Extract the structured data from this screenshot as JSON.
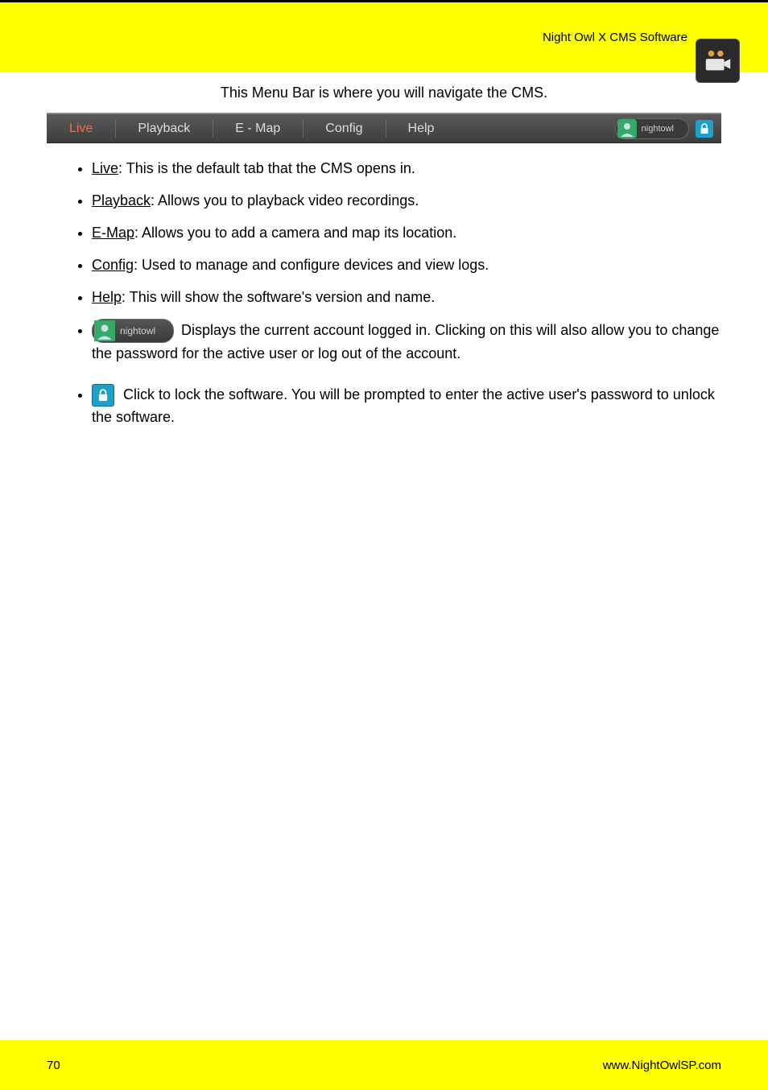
{
  "header": {
    "right_text": "Night Owl X CMS Software"
  },
  "content": {
    "intro": "This Menu Bar is where you will navigate the CMS.",
    "menubar": {
      "tabs": [
        "Live",
        "Playback",
        "E - Map",
        "Config",
        "Help"
      ],
      "username": "nightowl"
    },
    "bullets": {
      "live": {
        "label": "Live",
        "desc": ": This is the default tab that the CMS opens in."
      },
      "playback": {
        "label": "Playback",
        "desc": ": Allows you to playback video recordings."
      },
      "emap": {
        "label": "E-Map",
        "desc": ": Allows you to add a camera and map its location."
      },
      "config": {
        "label": "Config",
        "desc": ": Used to manage and configure devices and view logs."
      },
      "help": {
        "label": "Help",
        "desc": ": This will show the software's version and name."
      },
      "user": {
        "username": "nightowl",
        "desc": "Displays the current account logged in. Clicking on this will also allow you to change the password for the active user or log out of the account."
      },
      "lock": {
        "desc": "Click to lock the software. You will be prompted to enter the active user's password to unlock the software."
      }
    }
  },
  "footer": {
    "page": "70",
    "url": "www.NightOwlSP.com"
  }
}
